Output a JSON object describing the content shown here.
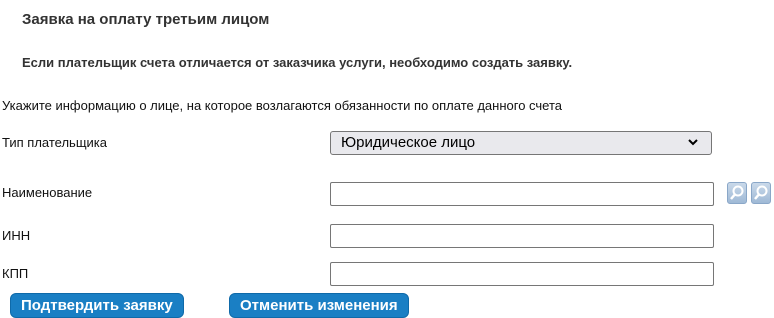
{
  "page": {
    "title": "Заявка на оплату третьим лицом",
    "notice": "Если плательщик счета отличается от заказчика услуги, необходимо создать заявку.",
    "hint": "Укажите информацию о лице, на которое возлагаются обязанности по оплате данного счета"
  },
  "form": {
    "payer_type_label": "Тип плательщика",
    "payer_type_value": "Юридическое лицо",
    "name_label": "Наименование",
    "name_value": "",
    "inn_label": "ИНН",
    "inn_value": "",
    "kpp_label": "КПП",
    "kpp_value": ""
  },
  "actions": {
    "confirm_label": "Подтвердить заявку",
    "cancel_label": "Отменить изменения"
  },
  "icons": [
    "search-icon",
    "search-icon"
  ],
  "colors": {
    "button_bg": "#1a7fc4",
    "select_bg": "#e9e9ed"
  }
}
